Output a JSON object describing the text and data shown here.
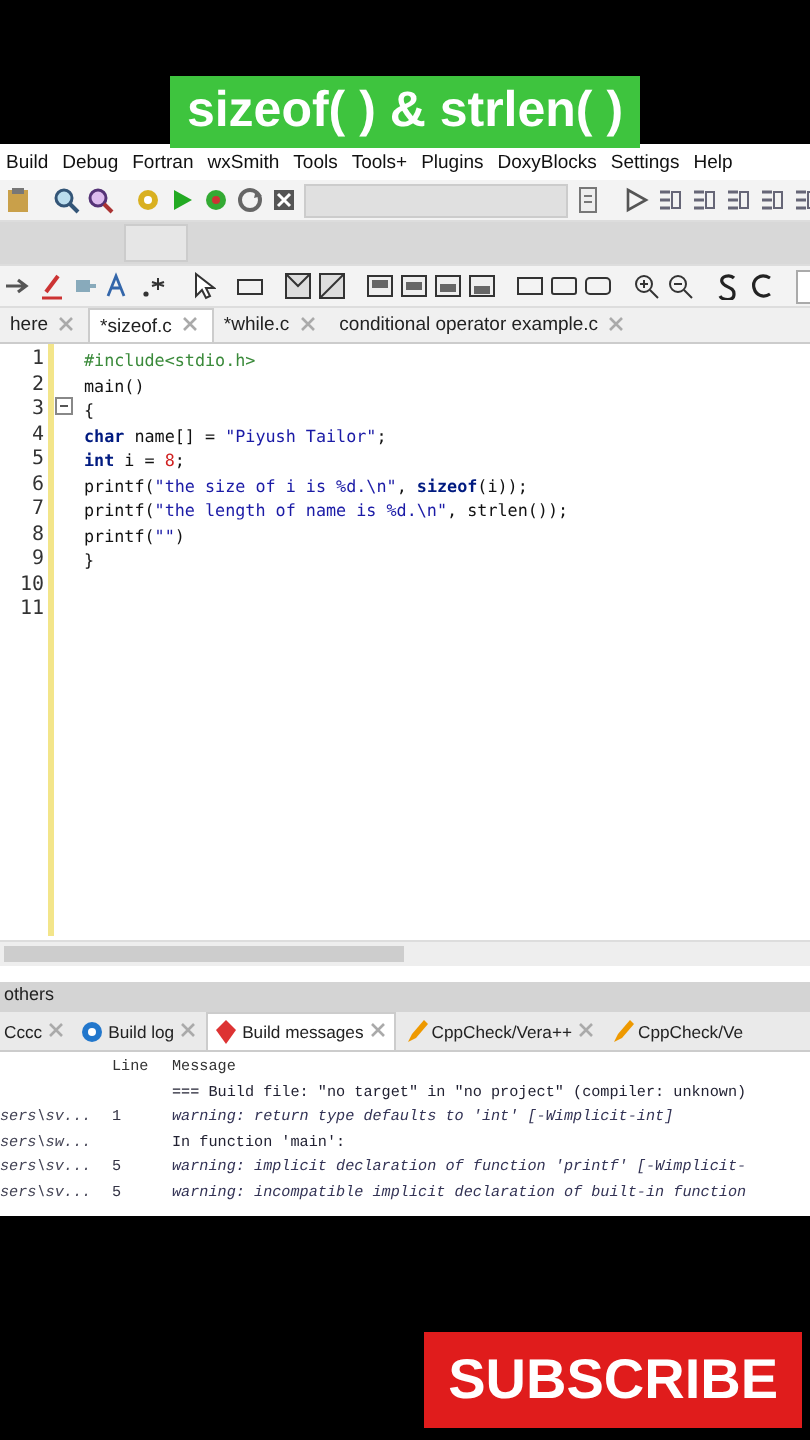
{
  "banner": {
    "title": "sizeof( ) & strlen( )"
  },
  "menu": [
    "Build",
    "Debug",
    "Fortran",
    "wxSmith",
    "Tools",
    "Tools+",
    "Plugins",
    "DoxyBlocks",
    "Settings",
    "Help"
  ],
  "editor_tabs": [
    {
      "label": "here",
      "selected": false
    },
    {
      "label": "*sizeof.c",
      "selected": true
    },
    {
      "label": "*while.c",
      "selected": false
    },
    {
      "label": "conditional operator example.c",
      "selected": false
    }
  ],
  "code": [
    {
      "number": "1",
      "segments": [
        {
          "kind": "preproc",
          "text": "#include<stdio.h>"
        }
      ]
    },
    {
      "number": "2",
      "segments": [
        {
          "kind": "plain",
          "text": "main()"
        }
      ]
    },
    {
      "number": "3",
      "fold": true,
      "segments": [
        {
          "kind": "plain",
          "text": "{"
        }
      ]
    },
    {
      "number": "4",
      "segments": [
        {
          "kind": "keyword",
          "text": "char"
        },
        {
          "kind": "plain",
          "text": " name[] = "
        },
        {
          "kind": "string",
          "text": "\"Piyush Tailor\""
        },
        {
          "kind": "plain",
          "text": ";"
        }
      ]
    },
    {
      "number": "5",
      "segments": [
        {
          "kind": "keyword",
          "text": "int"
        },
        {
          "kind": "plain",
          "text": " i = "
        },
        {
          "kind": "number",
          "text": "8"
        },
        {
          "kind": "plain",
          "text": ";"
        }
      ]
    },
    {
      "number": "6",
      "segments": [
        {
          "kind": "plain",
          "text": "printf("
        },
        {
          "kind": "string",
          "text": "\"the size of i is %d.\\n\""
        },
        {
          "kind": "plain",
          "text": ", "
        },
        {
          "kind": "keyword",
          "text": "sizeof"
        },
        {
          "kind": "plain",
          "text": "(i));"
        }
      ]
    },
    {
      "number": "7",
      "segments": [
        {
          "kind": "plain",
          "text": "printf("
        },
        {
          "kind": "string",
          "text": "\"the length of name is %d.\\n\""
        },
        {
          "kind": "plain",
          "text": ", strlen());"
        }
      ]
    },
    {
      "number": "8",
      "segments": [
        {
          "kind": "plain",
          "text": "printf("
        },
        {
          "kind": "string",
          "text": "\"\""
        },
        {
          "kind": "plain",
          "text": ")"
        }
      ]
    },
    {
      "number": "9",
      "segments": [
        {
          "kind": "plain",
          "text": "}"
        }
      ]
    },
    {
      "number": "10"
    },
    {
      "number": "11"
    }
  ],
  "panel": {
    "title": "others",
    "tabs": [
      {
        "label": "Cccc",
        "selected": false
      },
      {
        "label": "Build log",
        "selected": false
      },
      {
        "label": "Build messages",
        "selected": true
      },
      {
        "label": "CppCheck/Vera++",
        "selected": false
      },
      {
        "label": "CppCheck/Ve",
        "selected": false
      }
    ],
    "columns": [
      "Line",
      "Message"
    ],
    "rows": [
      {
        "message": "=== Build file: \"no target\" in \"no project\" (compiler: unknown)",
        "italic": false
      },
      {
        "file": "sers\\sv...",
        "line": "1",
        "message": "warning: return type defaults to 'int' [-Wimplicit-int]",
        "italic": true
      },
      {
        "file": "sers\\sw...",
        "message": "In function 'main':",
        "italic": false
      },
      {
        "file": "sers\\sv...",
        "line": "5",
        "message": "warning: implicit declaration of function 'printf' [-Wimplicit-",
        "italic": true
      },
      {
        "file": "sers\\sv...",
        "line": "5",
        "message": "warning: incompatible implicit declaration of built-in function",
        "italic": true
      }
    ]
  },
  "subscribe": {
    "label": "SUBSCRIBE"
  }
}
